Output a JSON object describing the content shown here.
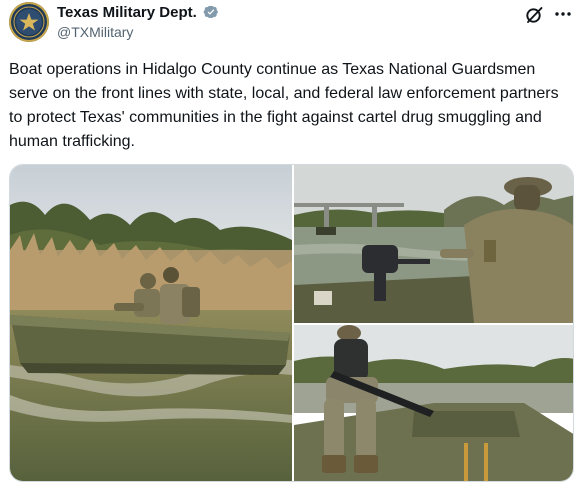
{
  "author": {
    "display_name": "Texas Military Dept.",
    "handle": "@TXMilitary",
    "verified_icon": "verified-badge-icon"
  },
  "actions": {
    "grok_icon": "grok-icon",
    "more_icon": "more-icon"
  },
  "post": {
    "text": "Boat operations in Hidalgo County continue as Texas National Guardsmen serve on the front lines with state, local, and federal law enforcement partners to protect Texas' communities in the fight against cartel drug smuggling and human trafficking."
  },
  "colors": {
    "text": "#0f1419",
    "secondary_text": "#536471",
    "verified": "#829aab",
    "border": "#cfd9de"
  }
}
